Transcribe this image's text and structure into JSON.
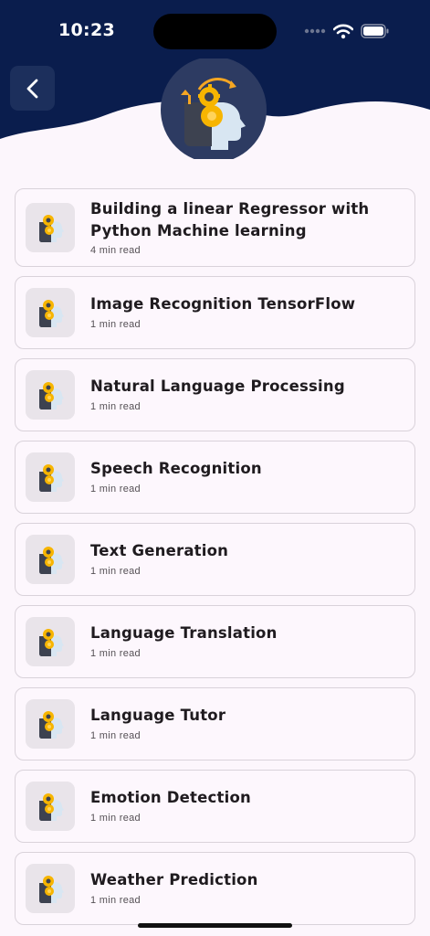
{
  "status_bar": {
    "time": "10:23",
    "wifi_icon": "wifi-icon",
    "battery_icon": "battery-icon"
  },
  "header": {
    "back_icon": "chevron-left-icon",
    "hero_icon": "ai-head-gear-icon",
    "background_color": "#0a1d4d"
  },
  "articles": [
    {
      "title": "Building a linear Regressor with Python Machine learning",
      "read_time": "4 min read",
      "icon": "ai-head-icon"
    },
    {
      "title": "Image Recognition TensorFlow",
      "read_time": "1 min read",
      "icon": "ai-head-icon"
    },
    {
      "title": "Natural Language Processing",
      "read_time": "1 min read",
      "icon": "ai-head-icon"
    },
    {
      "title": "Speech Recognition",
      "read_time": "1 min read",
      "icon": "ai-head-icon"
    },
    {
      "title": "Text Generation",
      "read_time": "1 min read",
      "icon": "ai-head-icon"
    },
    {
      "title": "Language Translation",
      "read_time": "1 min read",
      "icon": "ai-head-icon"
    },
    {
      "title": "Language Tutor",
      "read_time": "1 min read",
      "icon": "ai-head-icon"
    },
    {
      "title": "Emotion Detection",
      "read_time": "1 min read",
      "icon": "ai-head-icon"
    },
    {
      "title": "Weather Prediction",
      "read_time": "1 min read",
      "icon": "ai-head-icon"
    }
  ]
}
